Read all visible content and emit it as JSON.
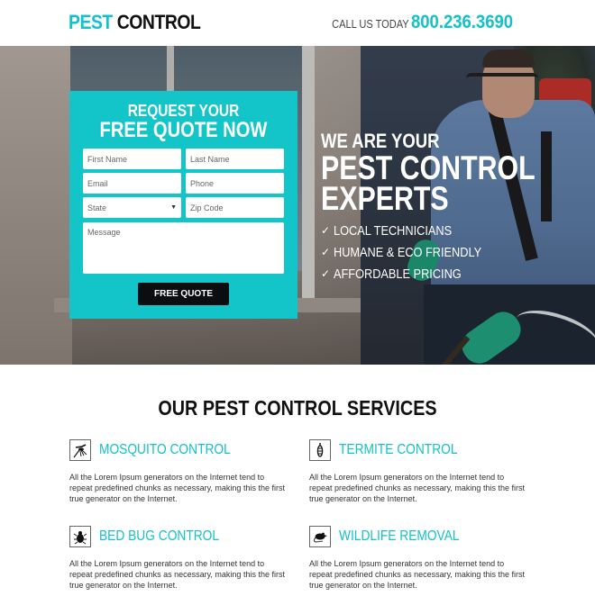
{
  "header": {
    "logo_accent": "PEST",
    "logo_rest": "CONTROL",
    "call_label": "CALL US TODAY",
    "phone": "800.236.3690"
  },
  "colors": {
    "accent": "#13c2c6",
    "button": "#0c0d10"
  },
  "form": {
    "title_line1": "REQUEST YOUR",
    "title_line2": "FREE QUOTE NOW",
    "fields": {
      "first_name": "First Name",
      "last_name": "Last Name",
      "email": "Email",
      "phone": "Phone",
      "state": "State",
      "zip": "Zip Code",
      "message": "Message"
    },
    "submit_label": "FREE QUOTE"
  },
  "hero": {
    "line1": "WE ARE YOUR",
    "line2": "PEST CONTROL",
    "line3": "EXPERTS",
    "bullets": [
      "LOCAL TECHNICIANS",
      "HUMANE & ECO FRIENDLY",
      "AFFORDABLE PRICING"
    ],
    "check_icon": "✓"
  },
  "services": {
    "title": "OUR PEST CONTROL SERVICES",
    "items": [
      {
        "title": "MOSQUITO CONTROL",
        "icon": "mosquito-icon",
        "desc": "All the Lorem Ipsum generators on the Internet tend to repeat predefined chunks as necessary, making this the first true generator on the Internet."
      },
      {
        "title": "TERMITE CONTROL",
        "icon": "termite-icon",
        "desc": "All the Lorem Ipsum generators on the Internet tend to repeat predefined chunks as necessary, making this the first true generator on the Internet."
      },
      {
        "title": "BED BUG CONTROL",
        "icon": "bed-bug-icon",
        "desc": "All the Lorem Ipsum generators on the Internet tend to repeat predefined chunks as necessary, making this the first true generator on the Internet."
      },
      {
        "title": "WILDLIFE REMOVAL",
        "icon": "rat-icon",
        "desc": "All the Lorem Ipsum generators on the Internet tend to repeat predefined chunks as necessary, making this the first true generator on the Internet."
      }
    ]
  }
}
